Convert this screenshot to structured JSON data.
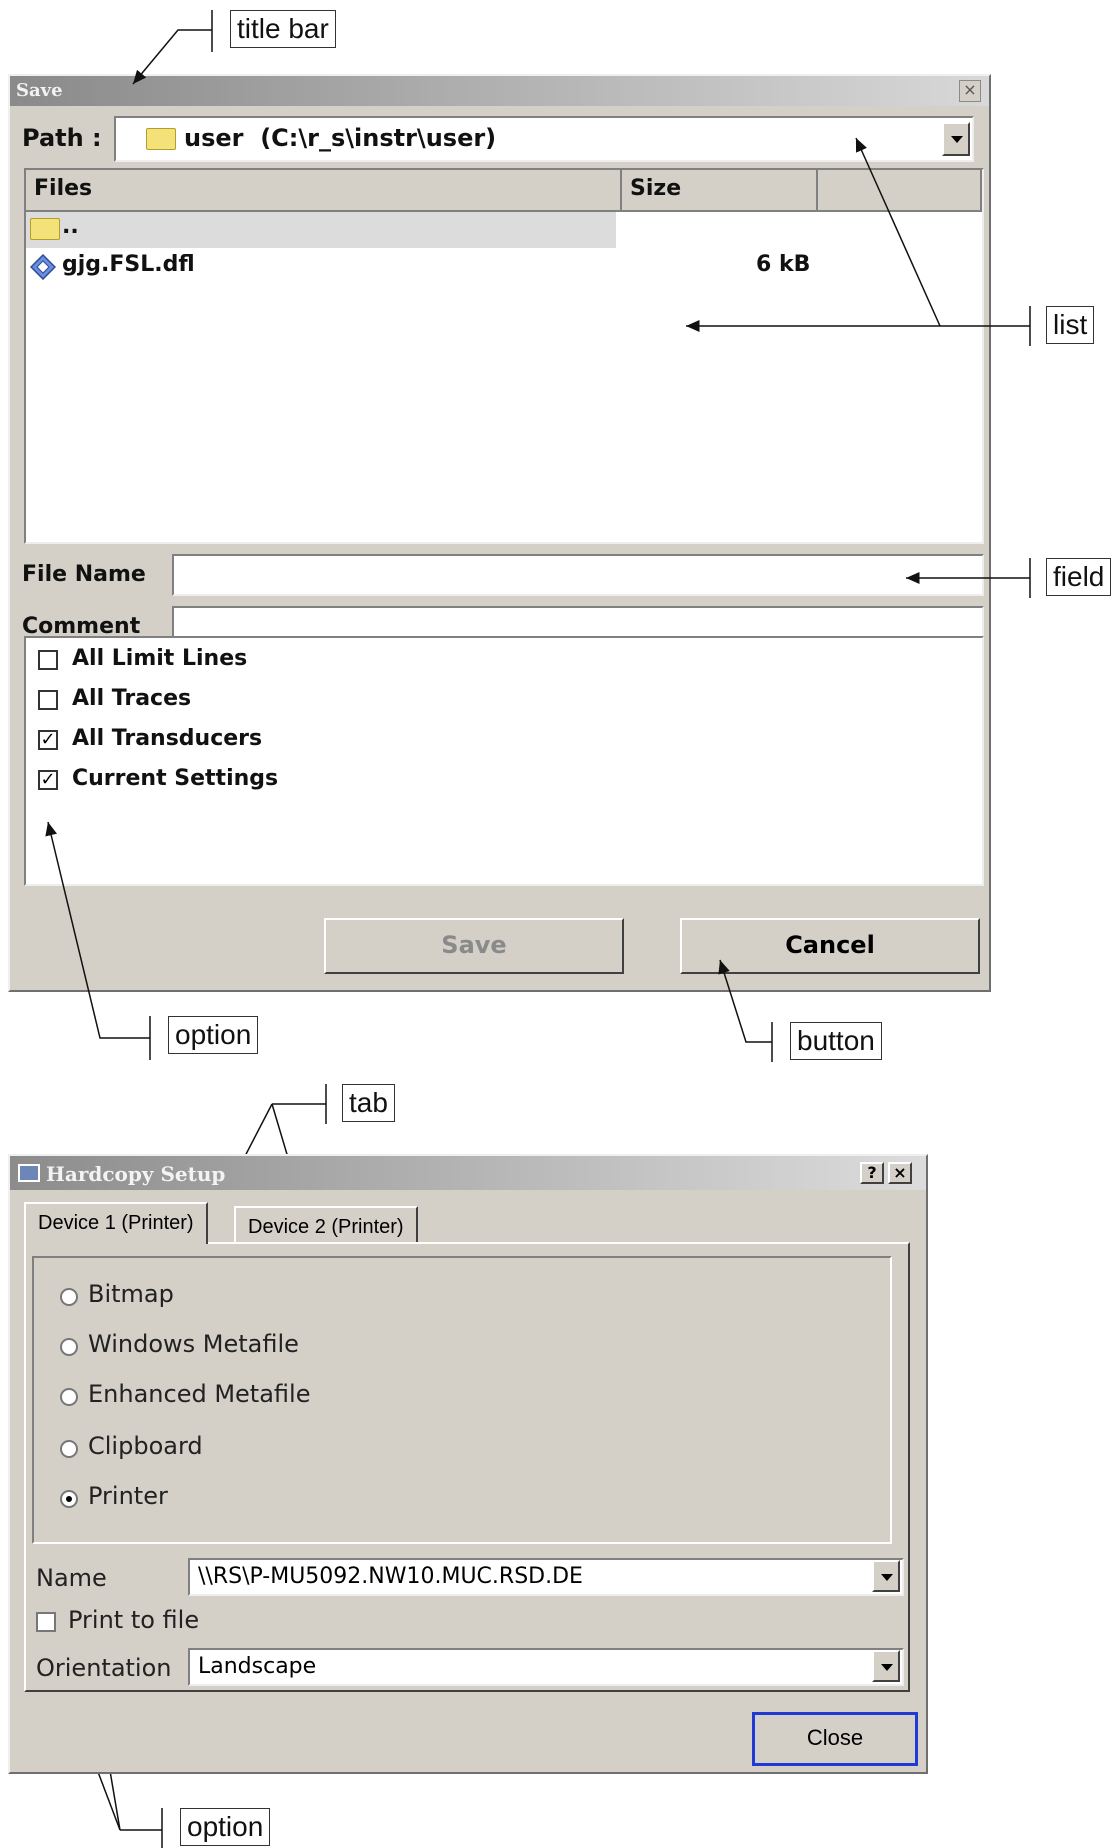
{
  "save_dialog": {
    "title": "Save",
    "close_glyph": "×",
    "path_label": "Path :",
    "path_value": "user  (C:\\r_s\\instr\\user)",
    "columns": {
      "files": "Files",
      "size": "Size"
    },
    "rows": [
      {
        "name": "..",
        "size": "",
        "icon": "folder-icon"
      },
      {
        "name": "gjg.FSL.dfl",
        "size": "6 kB",
        "icon": "settings-file-icon"
      }
    ],
    "file_name_label": "File Name",
    "file_name_value": "",
    "comment_label": "Comment",
    "comment_value": "",
    "options": [
      {
        "label": "All Limit Lines",
        "checked": false
      },
      {
        "label": "All Traces",
        "checked": false
      },
      {
        "label": "All Transducers",
        "checked": true
      },
      {
        "label": "Current Settings",
        "checked": true
      }
    ],
    "check_glyph": "✓",
    "save_button": "Save",
    "cancel_button": "Cancel"
  },
  "callouts": {
    "title_bar": "title bar",
    "list": "list",
    "field": "field",
    "option_top": "option",
    "button": "button",
    "tab": "tab",
    "option_bottom": "option"
  },
  "hardcopy_dialog": {
    "title": "Hardcopy Setup",
    "help_glyph": "?",
    "close_glyph": "×",
    "tabs": [
      "Device 1 (Printer)",
      "Device 2 (Printer)"
    ],
    "output_options": [
      {
        "label": "Bitmap",
        "selected": false
      },
      {
        "label": "Windows Metafile",
        "selected": false
      },
      {
        "label": "Enhanced Metafile",
        "selected": false
      },
      {
        "label": "Clipboard",
        "selected": false
      },
      {
        "label": "Printer",
        "selected": true
      }
    ],
    "name_label": "Name",
    "name_value": "\\\\RS\\P-MU5092.NW10.MUC.RSD.DE",
    "print_to_file_label": "Print to file",
    "print_to_file_checked": false,
    "orientation_label": "Orientation",
    "orientation_value": "Landscape",
    "close_button": "Close"
  }
}
